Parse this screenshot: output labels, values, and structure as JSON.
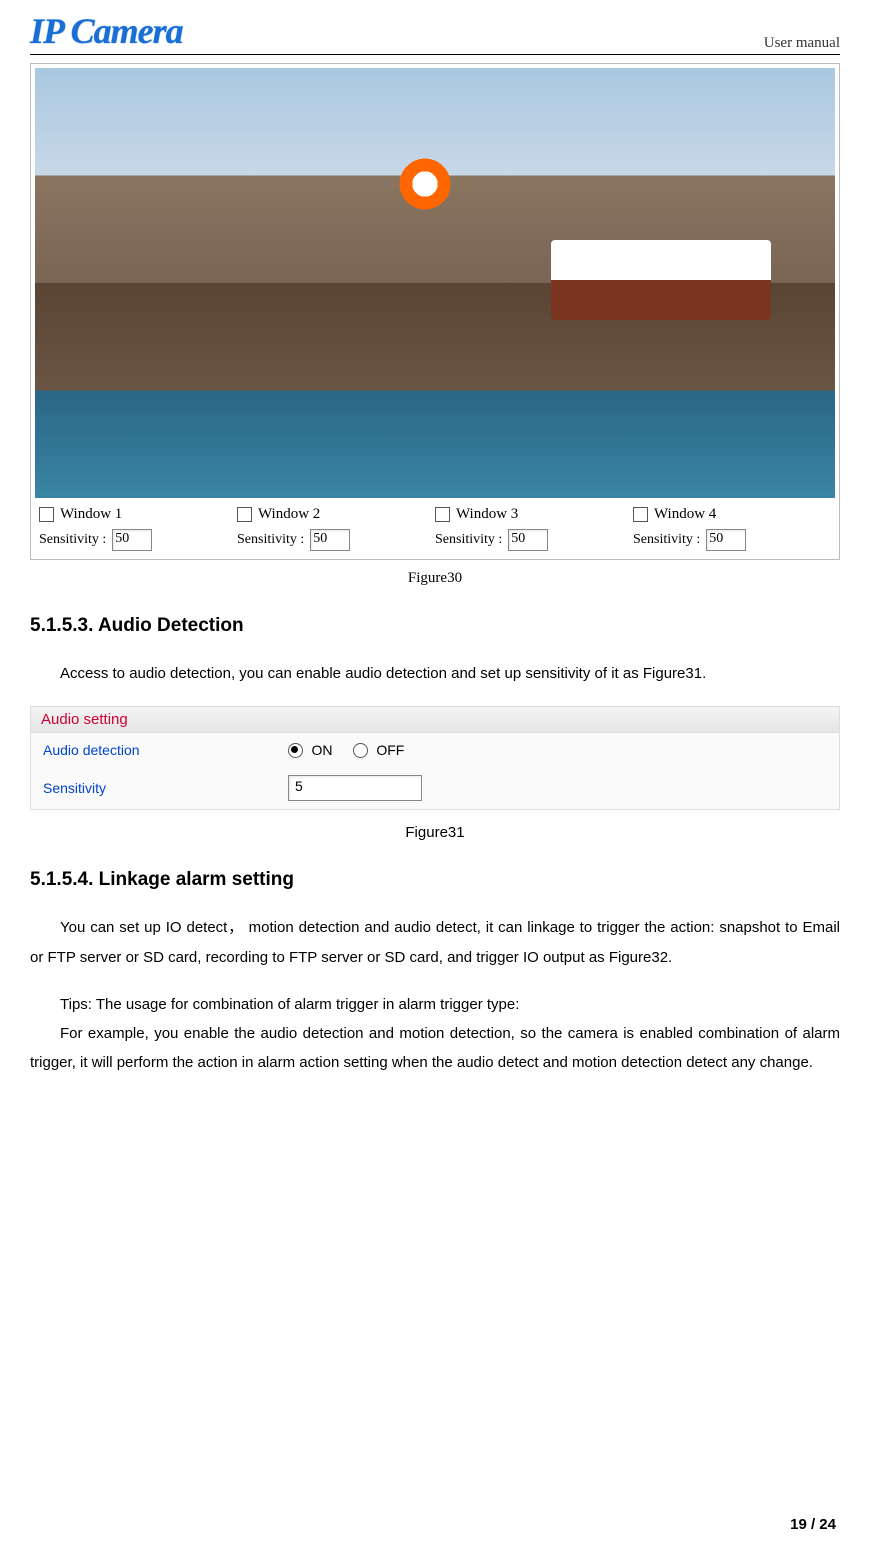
{
  "header": {
    "logo_text": "IP Camera",
    "right_text": "User manual"
  },
  "figure30": {
    "windows": [
      {
        "label": "Window 1",
        "sensitivity_label": "Sensitivity :",
        "value": "50"
      },
      {
        "label": "Window 2",
        "sensitivity_label": "Sensitivity :",
        "value": "50"
      },
      {
        "label": "Window 3",
        "sensitivity_label": "Sensitivity :",
        "value": "50"
      },
      {
        "label": "Window 4",
        "sensitivity_label": "Sensitivity :",
        "value": "50"
      }
    ],
    "caption": "Figure30"
  },
  "section_5153": {
    "heading": "5.1.5.3. Audio Detection",
    "intro": "Access to audio detection, you can enable audio detection and set up sensitivity of it as Figure31."
  },
  "figure31": {
    "panel_title": "Audio setting",
    "row1_label": "Audio detection",
    "row1_on": "ON",
    "row1_off": "OFF",
    "row2_label": "Sensitivity",
    "row2_value": "5",
    "caption": "Figure31"
  },
  "section_5154": {
    "heading": "5.1.5.4. Linkage alarm setting",
    "para1_lead": "You can set up IO detect，  motion detection and audio detect, it can linkage to trigger the action: snapshot to Email or FTP server or SD card, recording to FTP server or SD card, and trigger IO output as Figure32.",
    "tips_line": "Tips: The usage for combination of alarm trigger in alarm trigger type:",
    "tips_body": "For example, you enable the audio detection and motion detection, so the camera is enabled combination of alarm trigger, it will perform the action in alarm action setting when the audio detect and motion detection detect any change."
  },
  "footer": {
    "page_number": "19 / 24"
  }
}
